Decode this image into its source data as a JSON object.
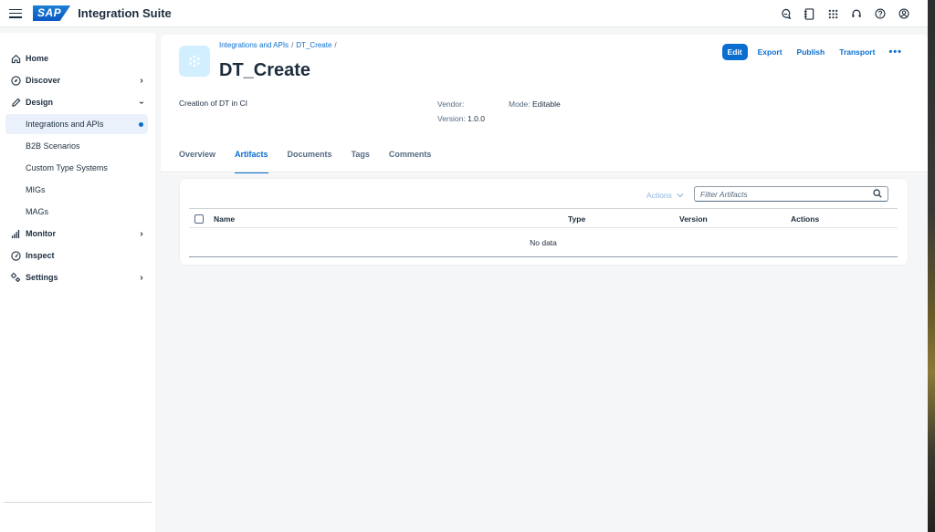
{
  "shell": {
    "logo": "SAP",
    "product": "Integration Suite",
    "icons": [
      "joule-icon",
      "notebook-icon",
      "app-grid-icon",
      "headset-icon",
      "help-icon",
      "user-icon"
    ]
  },
  "sidebar": {
    "items": [
      {
        "label": "Home",
        "icon": "home-icon"
      },
      {
        "label": "Discover",
        "icon": "compass-icon"
      },
      {
        "label": "Design",
        "icon": "pencil-icon"
      },
      {
        "label": "Integrations and APIs"
      },
      {
        "label": "B2B Scenarios"
      },
      {
        "label": "Custom Type Systems"
      },
      {
        "label": "MIGs"
      },
      {
        "label": "MAGs"
      },
      {
        "label": "Monitor",
        "icon": "bar-chart-icon"
      },
      {
        "label": "Inspect",
        "icon": "gauge-icon"
      },
      {
        "label": "Settings",
        "icon": "gear-icon"
      }
    ]
  },
  "header": {
    "breadcrumb": [
      "Integrations and APIs",
      "DT_Create"
    ],
    "breadcrumb_sep": "/",
    "title": "DT_Create",
    "description": "Creation of DT in CI",
    "vendor_label": "Vendor:",
    "vendor_value": "",
    "version_label": "Version:",
    "version_value": "1.0.0",
    "mode_label": "Mode:",
    "mode_value": "Editable",
    "actions": {
      "edit": "Edit",
      "export": "Export",
      "publish": "Publish",
      "transport": "Transport",
      "more": "•••"
    }
  },
  "tabs": [
    "Overview",
    "Artifacts",
    "Documents",
    "Tags",
    "Comments"
  ],
  "active_tab": "Artifacts",
  "table": {
    "actions_label": "Actions",
    "filter_placeholder": "Filter Artifacts",
    "columns": [
      "Name",
      "Type",
      "Version",
      "Actions"
    ],
    "empty_text": "No data"
  },
  "colors": {
    "accent": "#0a6ed1",
    "selected_bg": "#eaf1fa",
    "object_icon_bg": "#d1efff"
  }
}
